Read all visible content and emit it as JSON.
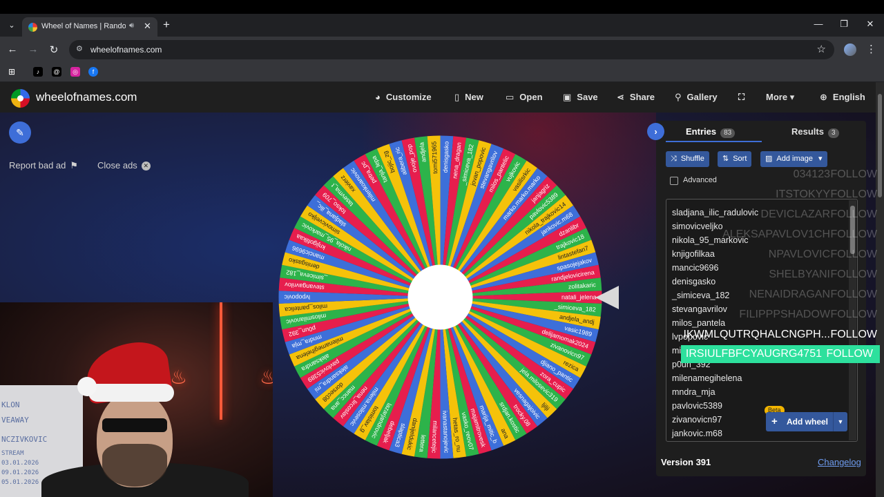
{
  "browser": {
    "tab_title": "Wheel of Names | Random",
    "url": "wheelofnames.com",
    "new_tab": "+",
    "window_controls": [
      "—",
      "❐",
      "✕"
    ]
  },
  "bookmarks": [
    {
      "icon": "apps-grid-icon",
      "label": "⊞",
      "color": "#35363a"
    },
    {
      "icon": "tiktok-icon",
      "label": "♪",
      "color": "#000000"
    },
    {
      "icon": "threads-icon",
      "label": "@",
      "color": "#000000"
    },
    {
      "icon": "instagram-icon",
      "label": "◎",
      "color": "#d6249f"
    },
    {
      "icon": "facebook-icon",
      "label": "f",
      "color": "#1877f2"
    }
  ],
  "site": {
    "title": "wheelofnames.com",
    "nav": [
      {
        "label": "Customize",
        "icon": "palette-icon",
        "glyph": "🎨"
      },
      {
        "label": "New",
        "icon": "file-icon",
        "glyph": "▯"
      },
      {
        "label": "Open",
        "icon": "folder-icon",
        "glyph": "▭"
      },
      {
        "label": "Save",
        "icon": "save-icon",
        "glyph": "▣"
      },
      {
        "label": "Share",
        "icon": "share-icon",
        "glyph": "⋖"
      },
      {
        "label": "Gallery",
        "icon": "search-icon",
        "glyph": "⚲"
      },
      {
        "label": "",
        "icon": "fullscreen-icon",
        "glyph": "⛶"
      },
      {
        "label": "More",
        "icon": "chevron-down-icon",
        "glyph": "▾"
      },
      {
        "label": "English",
        "icon": "globe-icon",
        "glyph": "⊕"
      }
    ],
    "report_ad": "Report bad ad",
    "close_ads": "Close ads"
  },
  "wheel": {
    "colors": [
      "#e61e4d",
      "#2db34a",
      "#f5c20a",
      "#3d6fd9"
    ],
    "names": [
      "natali_jelena",
      "_simiceva_182",
      "andjela_andj",
      "vasic1989",
      "delijamomak2024",
      "zivanovicn97",
      "rezica",
      "djiano_pantic",
      "zora_cupic",
      "jela.milosevic319",
      "ljilji",
      "vesnagajoivic",
      "trocky.08",
      "srdjan.kostic",
      "ana",
      "marija_mitic_b",
      "majamitrovesk",
      "vasko_reov07",
      "hetas_ro_nu",
      "ivanastanojevic",
      "milancetejic",
      "lettera",
      "danijeldukic",
      "slaptica3",
      "debeljak",
      "lazarjandrovic",
      "tomislav_g",
      "milena.milosevic",
      "nena_lircoslav",
      "mancc_ana",
      "dorsec08",
      "aleksandra_mi",
      "pavlovic5389",
      "aleksandra",
      "milenamegihelena",
      "mndra_mja",
      "p0un_392",
      "milosmilanovic",
      "milos_pantelica",
      "lvpopovic",
      "stevangavrilov",
      "_simiceva_182",
      "denisgasko",
      "mancic9696",
      "knjigofilkaa",
      "nikola_95_markovic",
      "simovicveljko",
      "sladjana_ilic_",
      "tokso_709",
      "tasevma_t",
      "xavierz",
      "milenkoanovic",
      "petra_pc",
      "tanja_lepa",
      "bojic_zg",
      "alibera_ric",
      "ovoje_pop",
      "andjela",
      "tomi571965",
      "denisgasko",
      "nena_dragan",
      "_simiceva_182",
      "jovan_popovic",
      "stevangavrilov",
      "milos_pantelic",
      "vujkovic",
      "vasilisrkic",
      "marko.marko.marko",
      "janjagriz",
      "pavlovic5389",
      "nikola_trajkovic14",
      "jankovic.m68",
      "dzanlibr",
      "trajkovic18",
      "lintastefan7",
      "spasojejakov",
      "randjelovicirena",
      "zolitakaric"
    ]
  },
  "panel": {
    "entries_label": "Entries",
    "entries_count": "83",
    "results_label": "Results",
    "results_count": "3",
    "shuffle": "Shuffle",
    "sort": "Sort",
    "add_image": "Add image",
    "advanced": "Advanced",
    "entries": [
      "sladjana_ilic_radulovic",
      "simovicveljko",
      "nikola_95_markovic",
      "knjigofilkaa",
      "mancic9696",
      "denisgasko",
      "_simiceva_182",
      "stevangavrilov",
      "milos_pantela",
      "lvpopovic",
      "mi",
      "p0un_392",
      "milenamegihelena",
      "mndra_mja",
      "pavlovic5389",
      "zivanovicn97",
      "jankovic.m68"
    ],
    "add_wheel": "Add wheel",
    "beta": "Beta",
    "version": "Version 391",
    "changelog": "Changelog"
  },
  "overlay": [
    {
      "name": "034123",
      "action": "FOLLOW",
      "style": "faded"
    },
    {
      "name": "ITSTOKYY",
      "action": "FOLLOW",
      "style": "faded"
    },
    {
      "name": "DEVICLAZAR",
      "action": "FOLLOW",
      "style": "faded"
    },
    {
      "name": "ALEKSAPAVLOV1CH",
      "action": "FOLLOW",
      "style": "faded"
    },
    {
      "name": "NPAVLOVIC",
      "action": "FOLLOW",
      "style": "faded"
    },
    {
      "name": "SHELBYANI",
      "action": "FOLLOW",
      "style": "faded"
    },
    {
      "name": "NENAIDRAGAN",
      "action": "FOLLOW",
      "style": "faded"
    },
    {
      "name": "FILIPPPSHADOW",
      "action": "FOLLOW",
      "style": "faded"
    },
    {
      "name": "IKWMLQUTRQHALCNGPH...",
      "action": "FOLLOW",
      "style": "bright"
    },
    {
      "name": "IRSIULFBFCYAUGRG4751",
      "action": "FOLLOW",
      "style": "green"
    }
  ],
  "webcam": {
    "whiteboard_lines": [
      "KLON",
      "VEAWAY",
      "NCZIVKOVIC",
      "STREAM",
      "03.01.2026",
      "09.01.2026",
      "05.01.2026"
    ]
  }
}
